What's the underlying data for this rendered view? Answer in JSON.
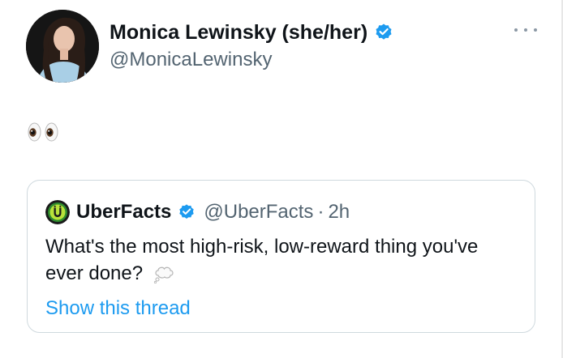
{
  "author": {
    "display_name": "Monica Lewinsky (she/her)",
    "handle": "@MonicaLewinsky",
    "verified_icon": "verified-badge-icon",
    "avatar_icon": "avatar"
  },
  "tweet": {
    "text_icon": "eyes-emoji-icon"
  },
  "more_menu": {
    "icon": "more-options-icon"
  },
  "quoted": {
    "display_name": "UberFacts",
    "handle": "@UberFacts",
    "separator": "·",
    "time": "2h",
    "text": "What's the most high-risk, low-reward thing you've ever done?",
    "emoji_icon": "thought-balloon-icon",
    "show_thread_label": "Show this thread",
    "avatar_icon": "uberfacts-logo-icon"
  },
  "colors": {
    "accent": "#1d9bf0",
    "secondary_text": "#536471",
    "primary_text": "#0f1419",
    "border": "#cfd9de",
    "uberfacts_green": "#2e8b2e"
  }
}
